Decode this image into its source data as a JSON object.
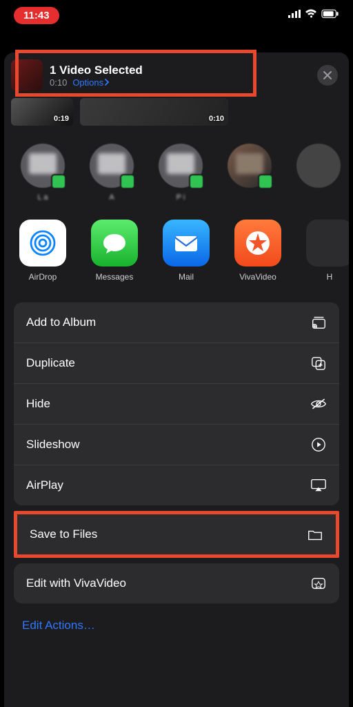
{
  "status": {
    "time": "11:43"
  },
  "header": {
    "title": "1 Video Selected",
    "duration": "0:10",
    "options_label": "Options"
  },
  "videos": [
    {
      "duration": "0:19"
    },
    {
      "duration": "0:10"
    }
  ],
  "contacts": [
    {
      "name": "L      a"
    },
    {
      "name": "A"
    },
    {
      "name": "P   i"
    },
    {
      "name": " "
    }
  ],
  "apps": [
    {
      "key": "airdrop",
      "label": "AirDrop"
    },
    {
      "key": "messages",
      "label": "Messages"
    },
    {
      "key": "mail",
      "label": "Mail"
    },
    {
      "key": "vivavideo",
      "label": "VivaVideo"
    },
    {
      "key": "other",
      "label": "H"
    }
  ],
  "actions": {
    "add_to_album": "Add to Album",
    "duplicate": "Duplicate",
    "hide": "Hide",
    "slideshow": "Slideshow",
    "airplay": "AirPlay",
    "save_to_files": "Save to Files",
    "edit_vivavideo": "Edit with VivaVideo"
  },
  "edit_actions": "Edit Actions…",
  "colors": {
    "highlight": "#e8492e",
    "link": "#2f78ff"
  }
}
